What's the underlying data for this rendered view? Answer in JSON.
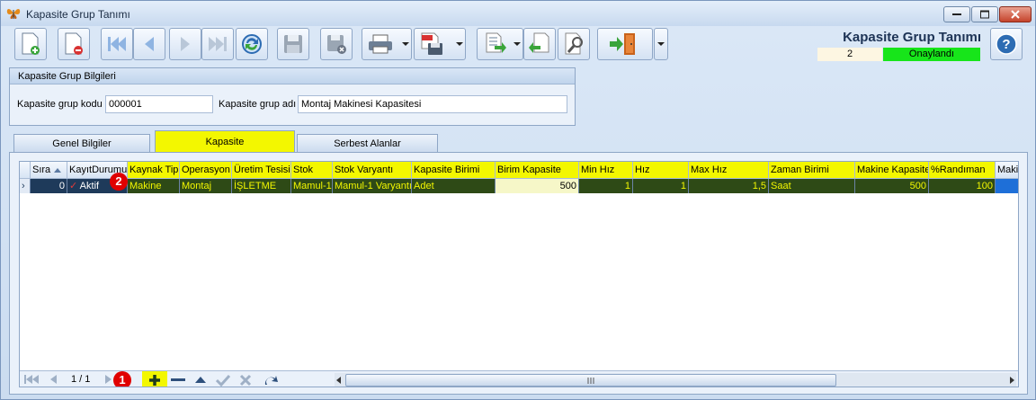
{
  "window": {
    "title": "Kapasite Grup Tanımı"
  },
  "header": {
    "title": "Kapasite Grup Tanımı",
    "record_number": "2",
    "status": "Onaylandı",
    "status_color": "#17e51a"
  },
  "toolbar": {
    "icons": [
      "new-document-icon",
      "delete-document-icon",
      "first-record-icon",
      "previous-record-icon",
      "next-record-icon",
      "last-record-icon",
      "refresh-icon",
      "save-icon",
      "save-cancel-icon",
      "print-icon",
      "pdf-export-icon",
      "export-icon",
      "import-icon",
      "settings-icon",
      "exit-icon",
      "help-icon"
    ]
  },
  "group": {
    "title": "Kapasite Grup Bilgileri",
    "code_label": "Kapasite grup kodu",
    "code_value": "000001",
    "name_label": "Kapasite grup adı",
    "name_value": "Montaj Makinesi Kapasitesi"
  },
  "tabs": [
    {
      "label": "Genel Bilgiler",
      "active": false
    },
    {
      "label": "Kapasite",
      "active": true
    },
    {
      "label": "Serbest Alanlar",
      "active": false
    }
  ],
  "grid": {
    "columns": [
      "Sıra",
      "KayıtDurumu",
      "Kaynak Tipi",
      "Operasyon",
      "Üretim Tesisi",
      "Stok",
      "Stok Varyantı",
      "Kapasite Birimi",
      "Birim Kapasite",
      "Min Hız",
      "Hız",
      "Max Hız",
      "Zaman Birimi",
      "Makine Kapasite",
      "%Randıman",
      "Makin"
    ],
    "rows": [
      [
        "0",
        "Aktif",
        "Makine",
        "Montaj",
        "İŞLETME",
        "Mamul-1",
        "Mamul-1 Varyantı",
        "Adet",
        "500",
        "1",
        "1",
        "1,5",
        "Saat",
        "500",
        "100",
        ""
      ]
    ],
    "highlight_color": "#f3f700"
  },
  "nav": {
    "pager": "1 / 1"
  },
  "markers": [
    "1",
    "2"
  ]
}
